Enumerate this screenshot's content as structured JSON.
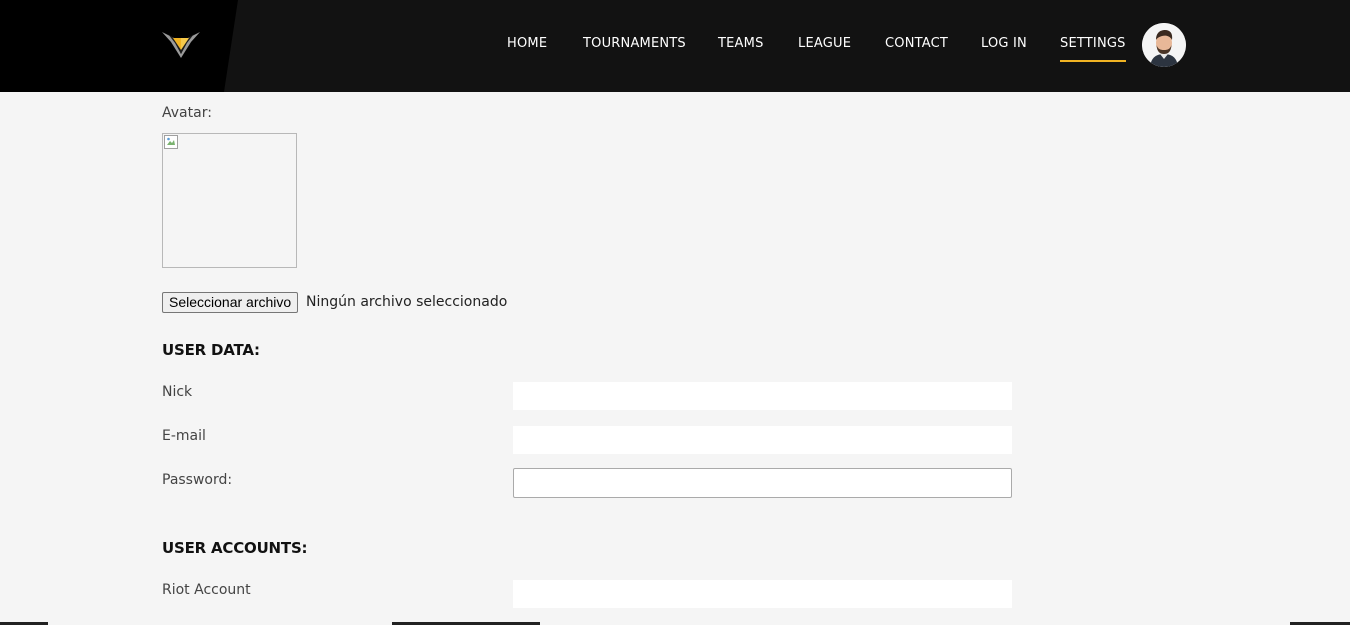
{
  "header": {
    "logo_icon": "v-wing-logo-icon",
    "nav": [
      {
        "label": "HOME"
      },
      {
        "label": "TOURNAMENTS"
      },
      {
        "label": "TEAMS"
      },
      {
        "label": "LEAGUE"
      },
      {
        "label": "CONTACT"
      },
      {
        "label": "LOG IN"
      },
      {
        "label": "SETTINGS",
        "active": true
      }
    ],
    "avatar_icon": "user-avatar-icon",
    "accent_color": "#f0b323"
  },
  "avatar_section": {
    "label": "Avatar:",
    "broken_image_icon": "broken-image-icon",
    "file_button": "Seleccionar archivo",
    "file_status": "Ningún archivo seleccionado"
  },
  "user_data": {
    "title": "USER DATA:",
    "fields": [
      {
        "label": "Nick",
        "value": ""
      },
      {
        "label": "E-mail",
        "value": ""
      },
      {
        "label": "Password:",
        "value": ""
      }
    ]
  },
  "user_accounts": {
    "title": "USER ACCOUNTS:",
    "fields": [
      {
        "label": "Riot Account",
        "value": ""
      }
    ]
  }
}
